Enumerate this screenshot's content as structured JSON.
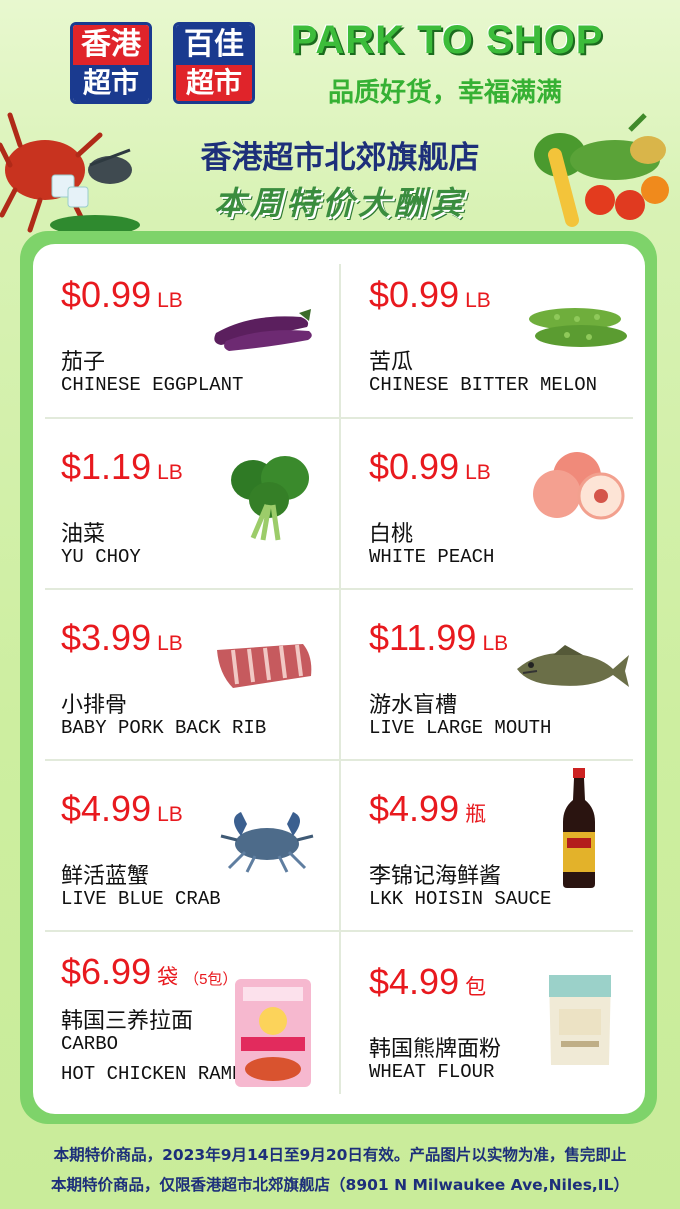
{
  "logos": [
    {
      "top": "香港",
      "bottom": "超市"
    },
    {
      "top": "百佳",
      "bottom": "超市"
    }
  ],
  "brand": "PARK TO SHOP",
  "slogan": "品质好货，幸福满满",
  "store_name": "香港超市北郊旗舰店",
  "promo_title": "本周特价大酬宾",
  "items": [
    {
      "price": "$0.99",
      "unit": "LB",
      "note": "",
      "cn": "茄子",
      "en": [
        "CHINESE EGGPLANT"
      ],
      "icon": "eggplant-icon"
    },
    {
      "price": "$0.99",
      "unit": "LB",
      "note": "",
      "cn": "苦瓜",
      "en": [
        "CHINESE BITTER MELON"
      ],
      "icon": "bitter-melon-icon"
    },
    {
      "price": "$1.19",
      "unit": "LB",
      "note": "",
      "cn": "油菜",
      "en": [
        "YU CHOY"
      ],
      "icon": "yu-choy-icon"
    },
    {
      "price": "$0.99",
      "unit": "LB",
      "note": "",
      "cn": "白桃",
      "en": [
        "WHITE PEACH"
      ],
      "icon": "peach-icon"
    },
    {
      "price": "$3.99",
      "unit": "LB",
      "note": "",
      "cn": "小排骨",
      "en": [
        "BABY PORK BACK RIB"
      ],
      "icon": "pork-rib-icon"
    },
    {
      "price": "$11.99",
      "unit": "LB",
      "note": "",
      "cn": "游水盲槽",
      "en": [
        "LIVE LARGE MOUTH"
      ],
      "icon": "fish-icon"
    },
    {
      "price": "$4.99",
      "unit": "LB",
      "note": "",
      "cn": "鲜活蓝蟹",
      "en": [
        "LIVE BLUE CRAB"
      ],
      "icon": "crab-icon"
    },
    {
      "price": "$4.99",
      "unit": "瓶",
      "note": "",
      "cn": "李锦记海鲜酱",
      "en": [
        "LKK HOISIN SAUCE"
      ],
      "icon": "sauce-bottle-icon"
    },
    {
      "price": "$6.99",
      "unit": "袋",
      "note": "（5包）",
      "cn": "韩国三养拉面",
      "en": [
        "CARBO",
        "HOT CHICKEN RAMEN"
      ],
      "icon": "ramen-pack-icon"
    },
    {
      "price": "$4.99",
      "unit": "包",
      "note": "",
      "cn": "韩国熊牌面粉",
      "en": [
        "WHEAT FLOUR"
      ],
      "icon": "flour-bag-icon"
    }
  ],
  "footer": [
    "本期特价商品，2023年9月14日至9月20日有效。产品图片以实物为准，售完即止",
    "本期特价商品，仅限香港超市北郊旗舰店（8901 N Milwaukee Ave,Niles,IL）"
  ],
  "colors": {
    "price": "#e8191e",
    "brand": "#3cbc3a",
    "store": "#1d2f7a",
    "frame": "#7ed36a"
  }
}
